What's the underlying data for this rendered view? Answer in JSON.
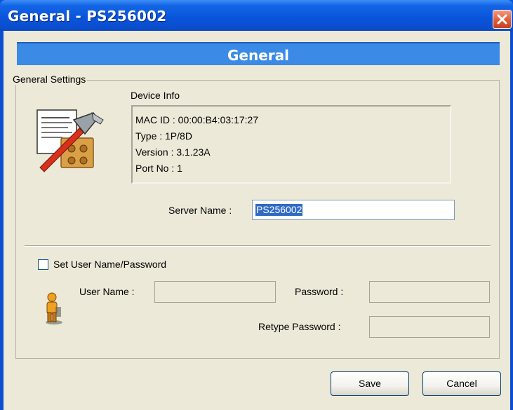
{
  "window": {
    "title": "General - PS256002"
  },
  "header": {
    "title": "General"
  },
  "group": {
    "legend": "General Settings"
  },
  "device_info": {
    "label": "Device Info",
    "lines": [
      "MAC ID : 00:00:B4:03:17:27",
      "Type : 1P/8D",
      "Version : 3.1.23A",
      "Port No : 1"
    ]
  },
  "server": {
    "label": "Server Name :",
    "value": "PS256002"
  },
  "auth": {
    "checkbox_label": "Set User Name/Password",
    "checked": false,
    "username_label": "User Name :",
    "password_label": "Password :",
    "retype_label": "Retype Password :",
    "username_value": "",
    "password_value": "",
    "retype_value": ""
  },
  "buttons": {
    "save": "Save",
    "cancel": "Cancel"
  },
  "icons": {
    "close": "close-icon",
    "settings": "settings-tools-icon",
    "user": "user-icon"
  }
}
